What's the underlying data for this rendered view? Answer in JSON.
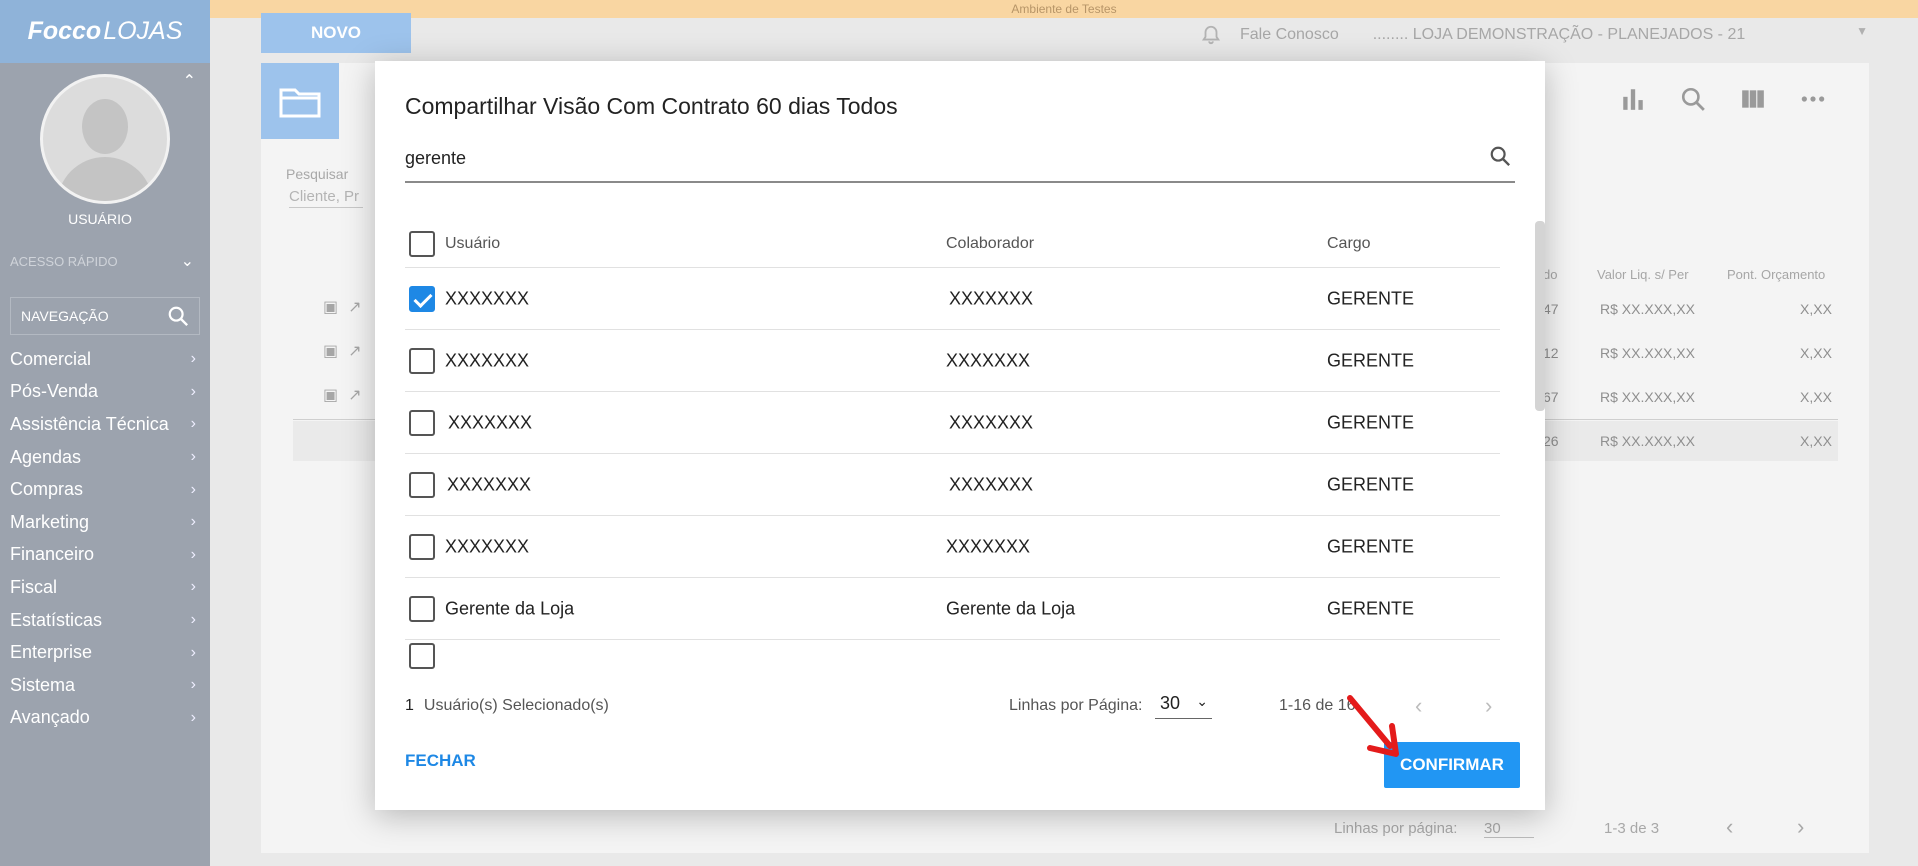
{
  "app": {
    "logo_part1": "Focco",
    "logo_part2": "LOJAS",
    "test_banner": "Ambiente de Testes"
  },
  "sidebar": {
    "username": "USUÁRIO",
    "quick_access": "ACESSO RÁPIDO",
    "nav_search_label": "NAVEGAÇÃO",
    "items": [
      {
        "label": "Comercial"
      },
      {
        "label": "Pós-Venda"
      },
      {
        "label": "Assistência Técnica"
      },
      {
        "label": "Agendas"
      },
      {
        "label": "Compras"
      },
      {
        "label": "Marketing"
      },
      {
        "label": "Financeiro"
      },
      {
        "label": "Fiscal"
      },
      {
        "label": "Estatísticas"
      },
      {
        "label": "Enterprise"
      },
      {
        "label": "Sistema"
      },
      {
        "label": "Avançado"
      }
    ]
  },
  "topbar": {
    "new_label": "NOVO",
    "contact": "Fale Conosco",
    "store": "........ LOJA DEMONSTRAÇÃO - PLANEJADOS - 21"
  },
  "background_page": {
    "search_label": "Pesquisar",
    "search_placeholder": "Cliente, Pr",
    "columns": [
      "do",
      "Valor Liq. s/ Per",
      "Pont. Orçamento"
    ],
    "rows": [
      {
        "c1": "47",
        "c2": "R$ XX.XXX,XX",
        "c3": "X,XX"
      },
      {
        "c1": "12",
        "c2": "R$ XX.XXX,XX",
        "c3": "X,XX"
      },
      {
        "c1": "67",
        "c2": "R$ XX.XXX,XX",
        "c3": "X,XX"
      }
    ],
    "total": {
      "c1": "26",
      "c2": "R$ XX.XXX,XX",
      "c3": "X,XX"
    },
    "rows_per_page_label": "Linhas por página:",
    "rows_per_page": "30",
    "range": "1-3 de 3"
  },
  "modal": {
    "title": "Compartilhar Visão Com Contrato 60 dias Todos",
    "search_value": "gerente",
    "columns": {
      "user": "Usuário",
      "colab": "Colaborador",
      "cargo": "Cargo"
    },
    "rows": [
      {
        "user": "XXXXXXX",
        "colab": "XXXXXXX",
        "cargo": "GERENTE",
        "checked": true
      },
      {
        "user": "XXXXXXX",
        "colab": "XXXXXXX",
        "cargo": "GERENTE",
        "checked": false
      },
      {
        "user": "XXXXXXX",
        "colab": "XXXXXXX",
        "cargo": "GERENTE",
        "checked": false
      },
      {
        "user": "XXXXXXX",
        "colab": "XXXXXXX",
        "cargo": "GERENTE",
        "checked": false
      },
      {
        "user": "XXXXXXX",
        "colab": "XXXXXXX",
        "cargo": "GERENTE",
        "checked": false
      },
      {
        "user": "Gerente da Loja",
        "colab": "Gerente da Loja",
        "cargo": "GERENTE",
        "checked": false
      }
    ],
    "selected_count": "1",
    "selected_label": "Usuário(s) Selecionado(s)",
    "rows_per_page_label": "Linhas por Página:",
    "rows_per_page": "30",
    "range": "1-16 de 16",
    "close_label": "FECHAR",
    "confirm_label": "CONFIRMAR"
  },
  "colors": {
    "primary": "#2196f3",
    "sidebar": "#9ca3ae",
    "logo_bg": "#8fb3d9",
    "arrow": "#e41b1b"
  }
}
